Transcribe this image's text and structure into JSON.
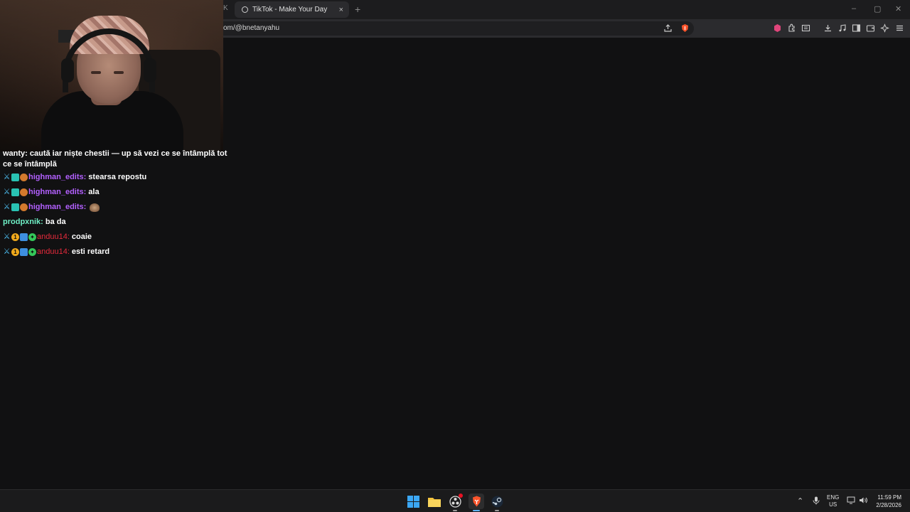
{
  "browser": {
    "prev_tab_fragment": "K",
    "active_tab_title": "TikTok - Make Your Day",
    "tab_close": "×",
    "new_tab": "+",
    "url": "om/@bnetanyahu",
    "window_controls": {
      "minimize": "–",
      "restore": "▢",
      "close": "✕"
    },
    "brand_color": "#fb542b"
  },
  "chat": {
    "partial_message": {
      "first_line": "wanty: caută iar niște chestii — up să vezi ce se întâmplă tot",
      "second_line": "ce se întâmplă"
    },
    "messages": [
      {
        "badges": [
          "sword",
          "tealgrid",
          "bear"
        ],
        "user": "highman_edits:",
        "user_color": "purple",
        "text": "stearsa repostu"
      },
      {
        "badges": [
          "sword",
          "tealgrid",
          "bear"
        ],
        "user": "highman_edits:",
        "user_color": "purple",
        "text": "ala"
      },
      {
        "badges": [
          "sword",
          "tealgrid",
          "bear"
        ],
        "user": "highman_edits:",
        "user_color": "purple",
        "text": "",
        "emote": true
      },
      {
        "badges": [],
        "user": "prodpxnik:",
        "user_color": "teal",
        "text": "ba da"
      },
      {
        "badges": [
          "sword",
          "one",
          "cube",
          "star"
        ],
        "user": "anduu14:",
        "user_color": "red",
        "text": "coaie"
      },
      {
        "badges": [
          "sword",
          "one",
          "cube",
          "star"
        ],
        "user": "anduu14:",
        "user_color": "red",
        "text": "esti retard"
      }
    ]
  },
  "taskbar": {
    "language": "ENG",
    "region": "US",
    "time": "11:59 PM",
    "date": "2/28/2026",
    "apps": [
      "windows-start",
      "file-explorer",
      "obs-studio",
      "brave-browser",
      "steam"
    ]
  }
}
